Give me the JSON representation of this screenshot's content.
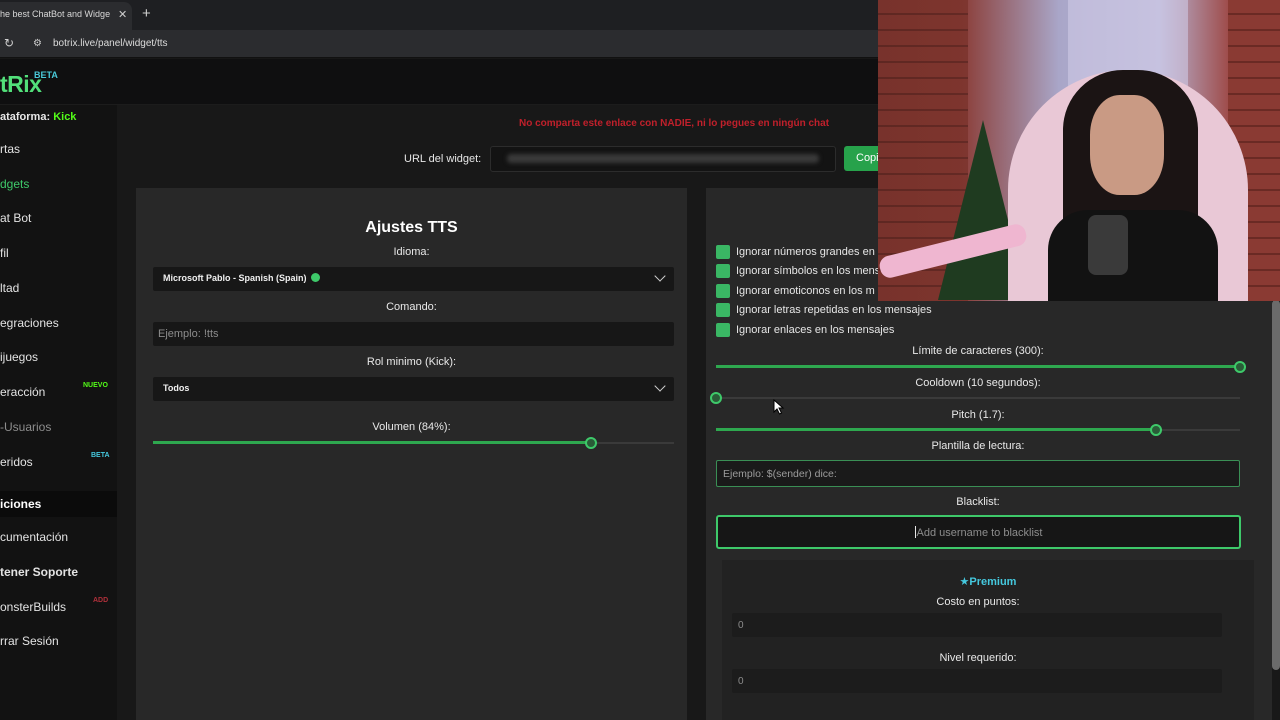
{
  "browser": {
    "tab_title": "he best ChatBot and Widgets",
    "tab_close": "✕",
    "new_tab": "+",
    "reload": "↻",
    "site_icon": "⚙",
    "url": "botrix.live/panel/widget/tts"
  },
  "header": {
    "logo": "tRix",
    "logo_badge": "BETA"
  },
  "sidebar": {
    "platform_label": "ataforma:",
    "platform_value": "Kick",
    "items": [
      {
        "label": "rtas"
      },
      {
        "label": "dgets"
      },
      {
        "label": "at Bot"
      },
      {
        "label": "fil"
      },
      {
        "label": "ltad"
      },
      {
        "label": "egraciones"
      },
      {
        "label": "ijuegos"
      },
      {
        "label": "eracción",
        "badge": "NUEVO"
      },
      {
        "label": "-Usuarios"
      },
      {
        "label": "eridos",
        "badge": "BETA"
      }
    ],
    "options_header": "iciones",
    "options": [
      {
        "label": "cumentación"
      },
      {
        "label": "tener Soporte"
      },
      {
        "label": "onsterBuilds",
        "badge": "ADD"
      },
      {
        "label": "rrar Sesión"
      }
    ]
  },
  "warning": "No comparta este enlace con NADIE, ni lo pegues en ningún chat",
  "widget_url": {
    "label": "URL del widget:",
    "copy_label": "Copi"
  },
  "tts": {
    "title": "Ajustes TTS",
    "language_label": "Idioma:",
    "language_value": "Microsoft Pablo - Spanish (Spain)",
    "command_label": "Comando:",
    "command_placeholder": "Ejemplo: !tts",
    "role_label": "Rol minimo (Kick):",
    "role_value": "Todos",
    "volume_label": "Volumen (84%):",
    "volume_percent": 84
  },
  "filters": [
    {
      "label": "Ignorar números grandes en",
      "checked": true
    },
    {
      "label": "Ignorar símbolos en los mens",
      "checked": true
    },
    {
      "label": "Ignorar emoticonos en los m",
      "checked": true
    },
    {
      "label": "Ignorar letras repetidas en los mensajes",
      "checked": true
    },
    {
      "label": "Ignorar enlaces en los mensajes",
      "checked": true
    }
  ],
  "char_limit": {
    "label": "Límite de caracteres (300):",
    "fraction": 1.0
  },
  "cooldown": {
    "label": "Cooldown (10 segundos):",
    "fraction": 0.0
  },
  "pitch": {
    "label": "Pitch (1.7):",
    "fraction": 0.84
  },
  "template": {
    "label": "Plantilla de lectura:",
    "placeholder": "Ejemplo: $(sender) dice:"
  },
  "blacklist": {
    "label": "Blacklist:",
    "placeholder": "Add username to blacklist"
  },
  "premium": {
    "title": "Premium",
    "star_icon": "★",
    "cost_label": "Costo en puntos:",
    "cost_value": "0",
    "level_label": "Nivel requerido:",
    "level_value": "0"
  },
  "colors": {
    "accent": "#3ec96a",
    "warning": "#c0202b",
    "premium": "#45c9df",
    "kick": "#53fc18"
  }
}
